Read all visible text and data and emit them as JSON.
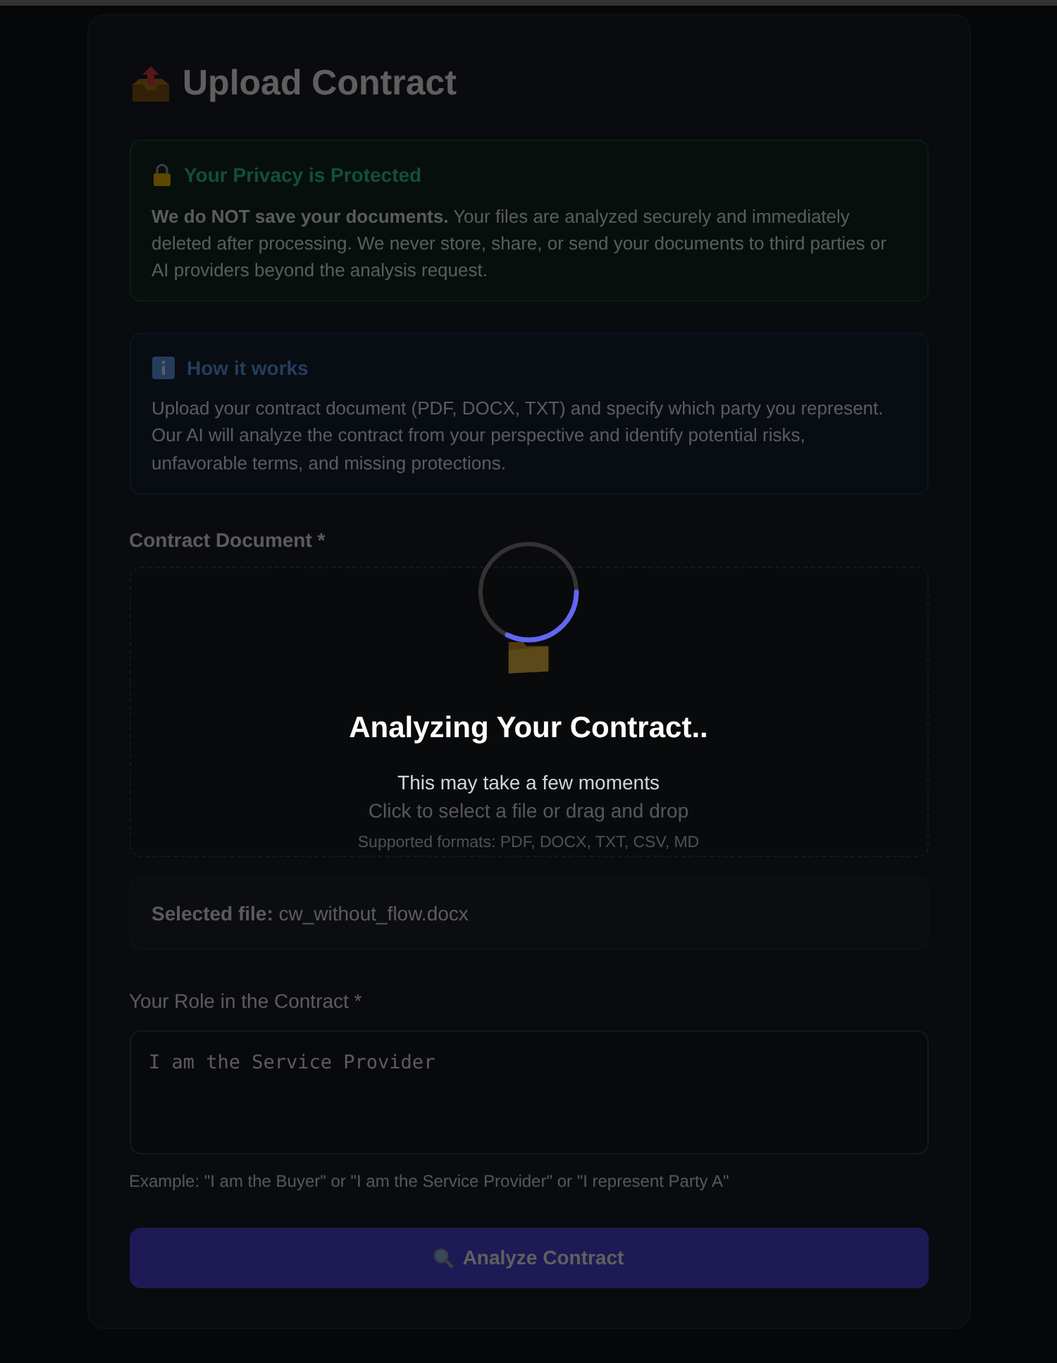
{
  "page": {
    "title": "Upload Contract"
  },
  "privacy_notice": {
    "title": "Your Privacy is Protected",
    "body": "**We do NOT save your documents.** Your files are analyzed securely and immediately deleted after processing. We never store, share, or send your documents to third parties or AI providers beyond the analysis request."
  },
  "how_it_works": {
    "title": "How it works",
    "body": "Upload your contract document (PDF, DOCX, TXT) and specify which party you represent. Our AI will analyze the contract from your perspective and identify potential risks, unfavorable terms, and missing protections."
  },
  "document_field": {
    "label": "Contract Document *",
    "prompt": "Click to select a file or drag and drop",
    "formats": "Supported formats: PDF, DOCX, TXT, CSV, MD"
  },
  "selected_file": {
    "text": "**Selected file:** cw_without_flow.docx"
  },
  "role_field": {
    "label": "Your Role in the Contract *",
    "value": "I am the Service Provider",
    "hint": "Example: \"I am the Buyer\" or \"I am the Service Provider\" or \"I represent Party A\""
  },
  "submit_button": {
    "label": "Analyze Contract"
  },
  "loading_overlay": {
    "visible": true,
    "title": "Analyzing Your Contract..",
    "subtitle": "This may take a few moments"
  }
}
